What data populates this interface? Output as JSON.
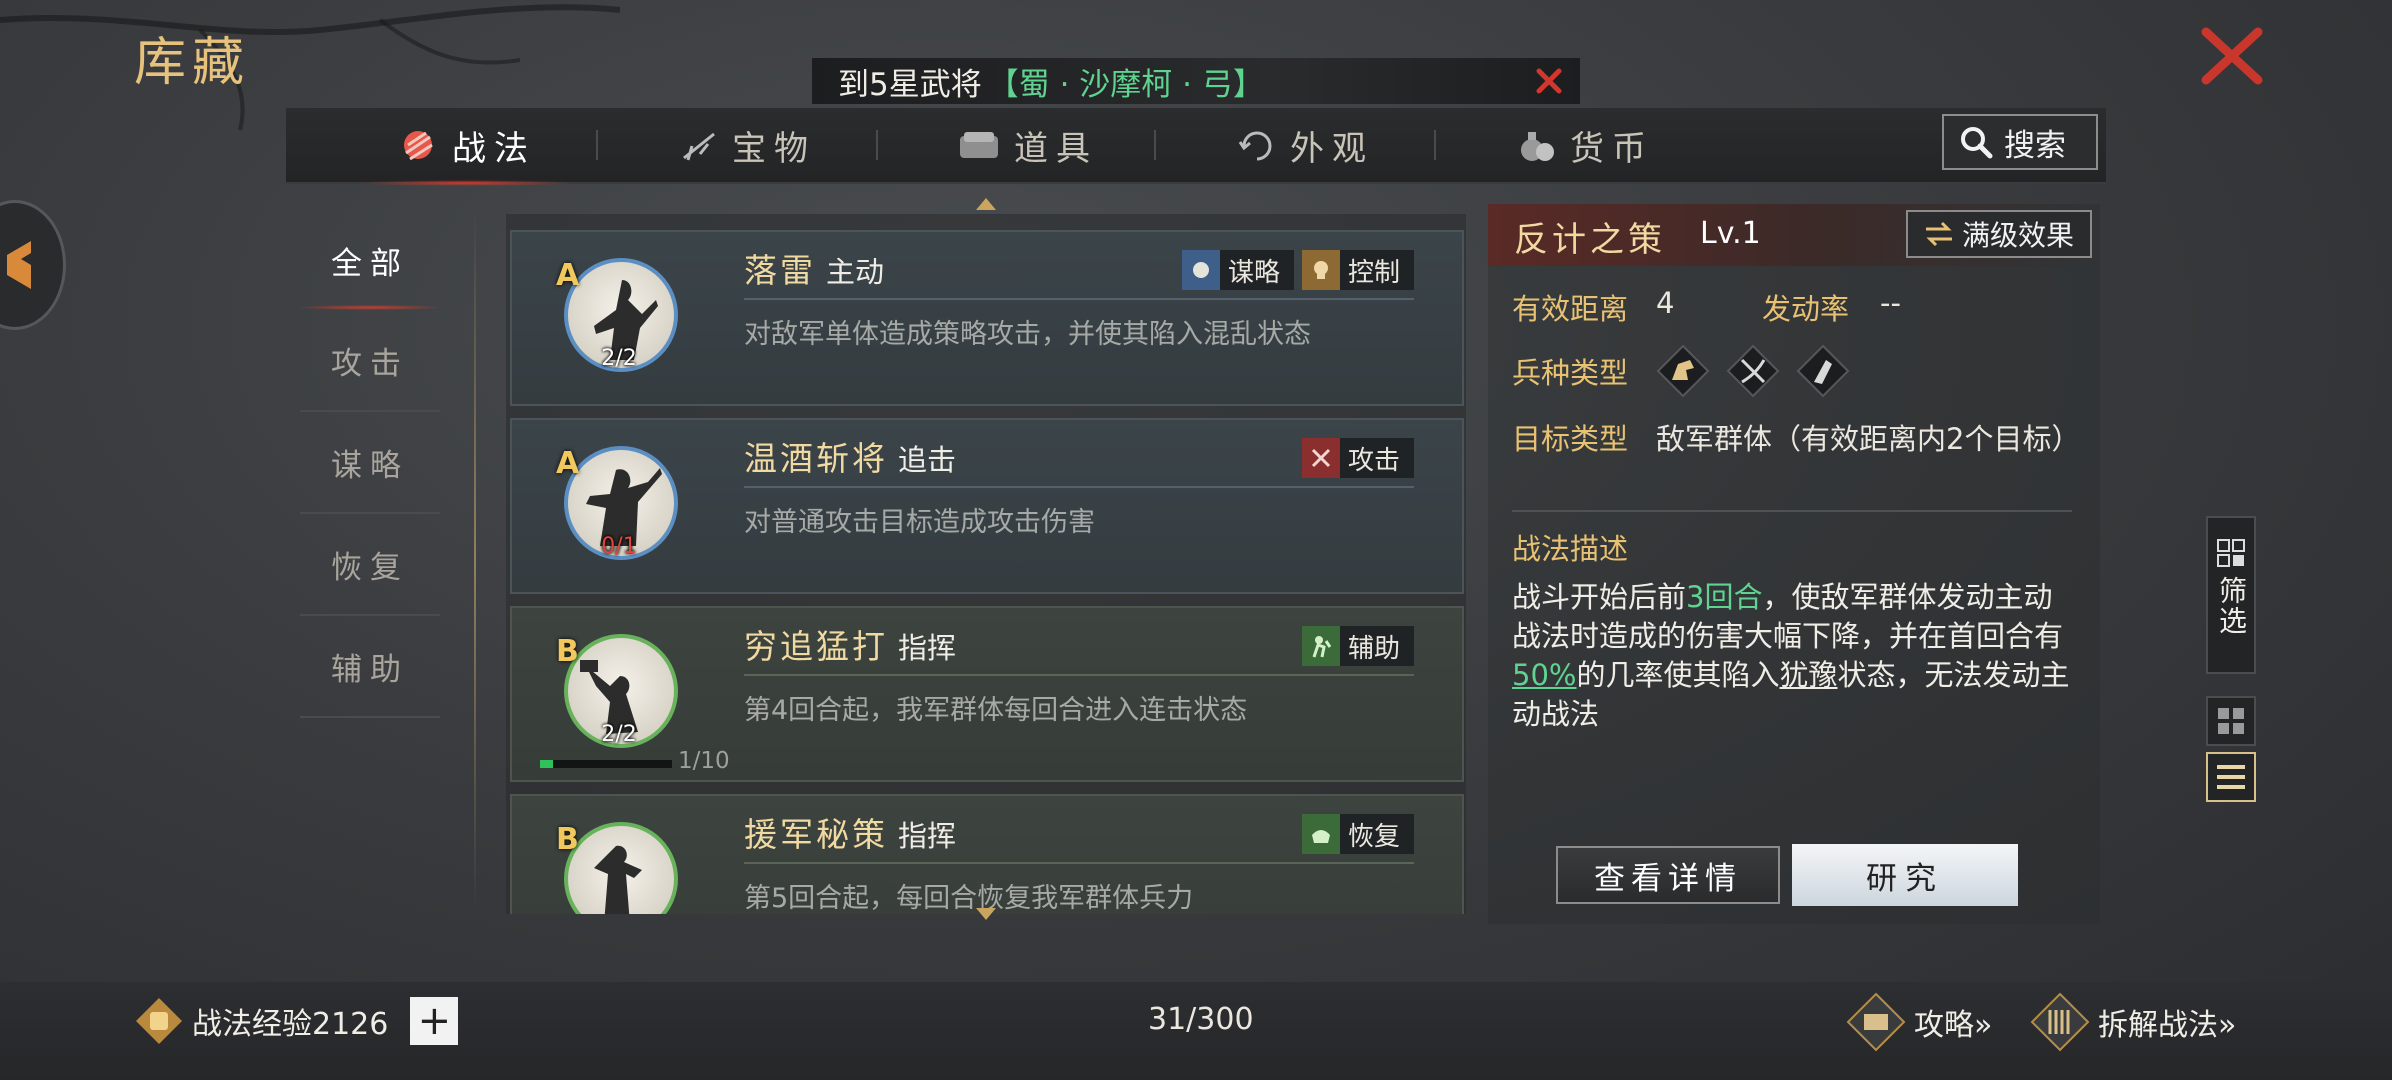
{
  "title": "库藏",
  "banner": {
    "text": "到5星武将",
    "hero": "【蜀 · 沙摩柯 · 弓】"
  },
  "tabs": [
    {
      "label": "战法",
      "icon": "scroll-bundle-icon"
    },
    {
      "label": "宝物",
      "icon": "treasure-icon"
    },
    {
      "label": "道具",
      "icon": "item-icon"
    },
    {
      "label": "外观",
      "icon": "appearance-icon"
    },
    {
      "label": "货币",
      "icon": "currency-icon"
    }
  ],
  "search_label": "搜索",
  "side_nav": [
    "全部",
    "攻击",
    "谋略",
    "恢复",
    "辅助"
  ],
  "skills": [
    {
      "grade": "A",
      "uses": "2/2",
      "name": "落雷",
      "type": "主动",
      "desc": "对敌军单体造成策略攻击，并使其陷入混乱状态",
      "tags": [
        {
          "label": "谋略",
          "icon": "strategy-icon"
        },
        {
          "label": "控制",
          "icon": "control-icon"
        }
      ]
    },
    {
      "grade": "A",
      "uses": "0/1",
      "name": "温酒斩将",
      "type": "追击",
      "desc": "对普通攻击目标造成攻击伤害",
      "tags": [
        {
          "label": "攻击",
          "icon": "attack-icon"
        }
      ]
    },
    {
      "grade": "B",
      "uses": "2/2",
      "name": "穷追猛打",
      "type": "指挥",
      "desc": "第4回合起，我军群体每回合进入连击状态",
      "progress": "1/10",
      "progress_fraction": 0.1,
      "tags": [
        {
          "label": "辅助",
          "icon": "support-icon"
        }
      ]
    },
    {
      "grade": "B",
      "uses": "",
      "name": "援军秘策",
      "type": "指挥",
      "desc": "第5回合起，每回合恢复我军群体兵力",
      "tags": [
        {
          "label": "恢复",
          "icon": "recover-icon"
        }
      ]
    }
  ],
  "detail": {
    "name": "反计之策",
    "level": "Lv.1",
    "max_level_btn": "满级效果",
    "range_label": "有效距离",
    "range_value": "4",
    "rate_label": "发动率",
    "rate_value": "--",
    "unit_label": "兵种类型",
    "unit_icons": [
      "cavalry-icon",
      "archer-icon",
      "infantry-icon"
    ],
    "target_label": "目标类型",
    "target_value": "敌军群体（有效距离内2个目标）",
    "desc_title": "战法描述",
    "desc_p1": "战斗开始后前",
    "desc_hl1": "3回合",
    "desc_p2": "，使敌军群体发动主动战法时造成的伤害大幅下降，并在首回合有",
    "desc_hl2": "50%",
    "desc_p3": "的几率使其陷入",
    "desc_ul": "犹豫",
    "desc_p4": "状态，无法发动主动战法"
  },
  "btn_detail": "查看详情",
  "btn_research": "研究",
  "filter_label": "筛选",
  "bottom": {
    "exp_label": "战法经验2126",
    "add": "+",
    "count": "31/300",
    "guide": "攻略»",
    "dismantle": "拆解战法»"
  },
  "colors": {
    "gold": "#e8c272",
    "green": "#5fd38f",
    "red": "#d43a2a"
  }
}
